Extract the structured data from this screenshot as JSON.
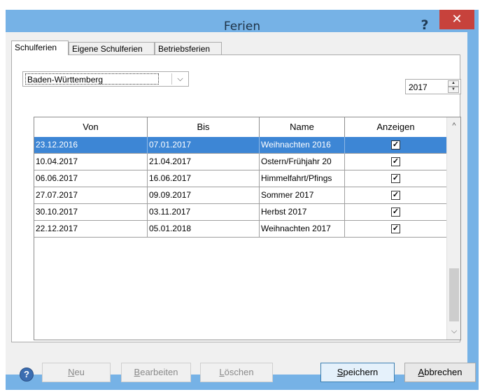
{
  "window": {
    "title": "Ferien",
    "help_glyph": "?",
    "close_glyph": "✕"
  },
  "tabs": [
    {
      "label": "Schulferien",
      "active": true
    },
    {
      "label": "Eigene Schulferien",
      "active": false
    },
    {
      "label": "Betriebsferien",
      "active": false
    }
  ],
  "state_select": {
    "value": "Baden-Württemberg",
    "arrow": "⌵"
  },
  "year_spinner": {
    "value": "2017",
    "up": "▲",
    "down": "▼"
  },
  "table": {
    "columns": [
      "Von",
      "Bis",
      "Name",
      "Anzeigen"
    ],
    "rows": [
      {
        "von": "23.12.2016",
        "bis": "07.01.2017",
        "name": "Weihnachten 2016",
        "anzeigen": true,
        "selected": true
      },
      {
        "von": "10.04.2017",
        "bis": "21.04.2017",
        "name": "Ostern/Frühjahr 20",
        "anzeigen": true,
        "selected": false
      },
      {
        "von": "06.06.2017",
        "bis": "16.06.2017",
        "name": "Himmelfahrt/Pfings",
        "anzeigen": true,
        "selected": false
      },
      {
        "von": "27.07.2017",
        "bis": "09.09.2017",
        "name": "Sommer 2017",
        "anzeigen": true,
        "selected": false
      },
      {
        "von": "30.10.2017",
        "bis": "03.11.2017",
        "name": "Herbst 2017",
        "anzeigen": true,
        "selected": false
      },
      {
        "von": "22.12.2017",
        "bis": "05.01.2018",
        "name": "Weihnachten 2017",
        "anzeigen": true,
        "selected": false
      }
    ],
    "check_glyph": "✓",
    "scroll_up": "^",
    "scroll_down": "⌵"
  },
  "footer": {
    "help_glyph": "?",
    "neu": {
      "acc": "N",
      "rest": "eu",
      "enabled": false
    },
    "bearbeiten": {
      "acc": "B",
      "rest": "earbeiten",
      "enabled": false
    },
    "loeschen": {
      "acc": "L",
      "rest": "öschen",
      "enabled": false
    },
    "speichern": {
      "acc": "S",
      "rest": "peichern",
      "enabled": true
    },
    "abbrechen": {
      "acc": "A",
      "rest": "bbrechen",
      "enabled": true
    }
  },
  "colors": {
    "title_bar": "#76b2e6",
    "close_button": "#c7423c",
    "selection": "#3d86d5"
  }
}
